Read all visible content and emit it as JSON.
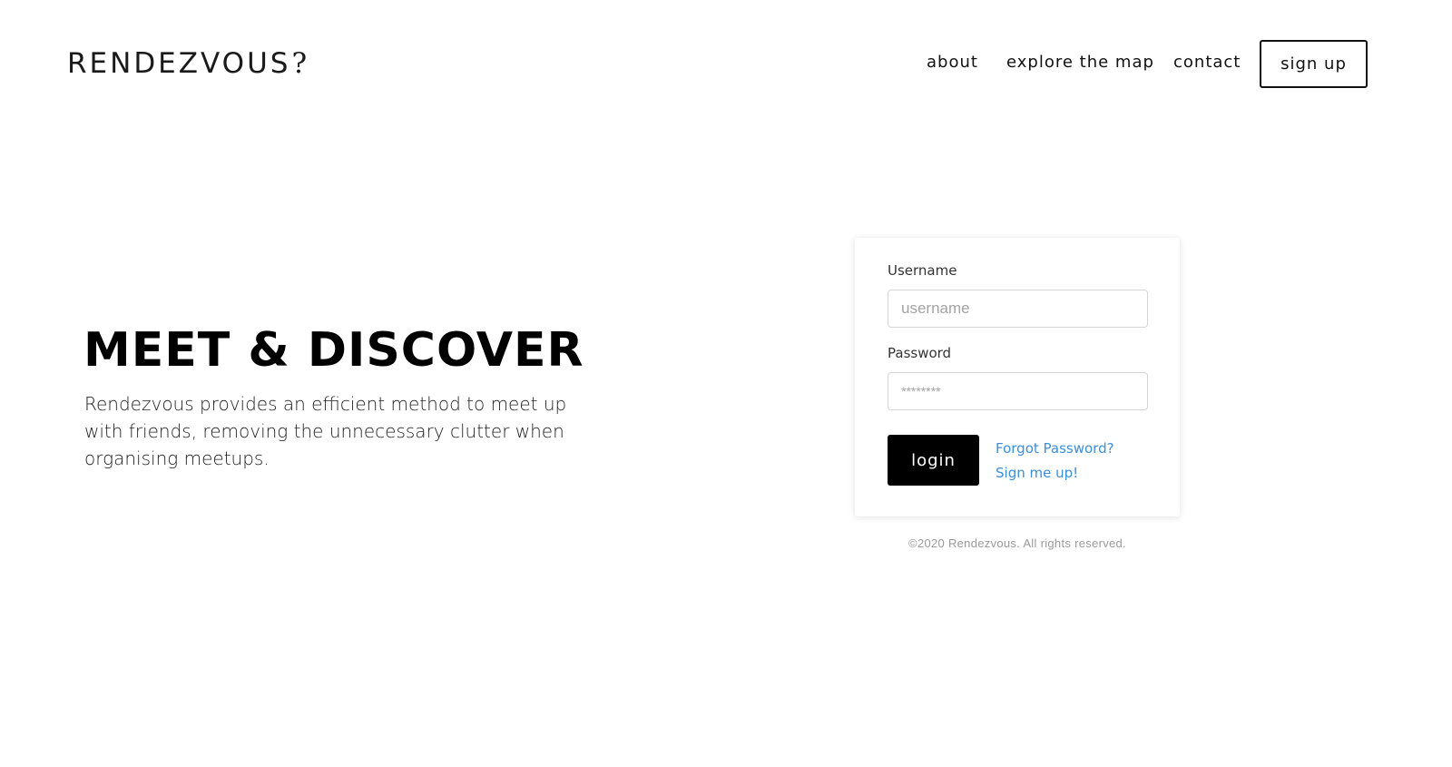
{
  "header": {
    "logo_text": "RENDEZVOUS",
    "logo_mark": "?",
    "nav": {
      "about": "about",
      "explore": "explore the map",
      "contact": "contact",
      "signup": "sign up"
    }
  },
  "hero": {
    "title": "MEET & DISCOVER",
    "description": "Rendezvous provides an efficient method to meet up with friends, removing the unnecessary clutter when organising meetups."
  },
  "login": {
    "username_label": "Username",
    "username_placeholder": "username",
    "password_label": "Password",
    "password_placeholder": "********",
    "login_label": "login",
    "forgot_label": "Forgot Password?",
    "signup_label": "Sign me up!"
  },
  "footer": {
    "copyright": "©2020 Rendezvous. All rights reserved."
  },
  "colors": {
    "link": "#3a8fd8",
    "primary": "#000000",
    "muted": "#9a9a9a"
  }
}
